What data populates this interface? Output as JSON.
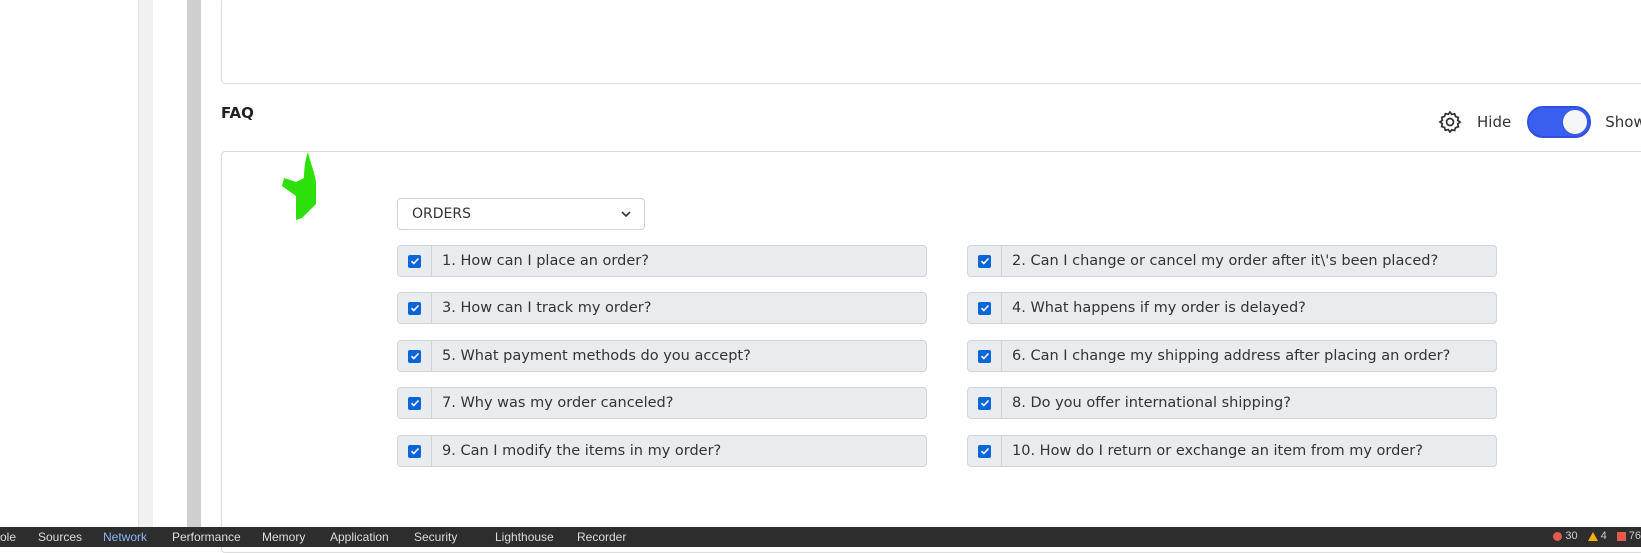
{
  "faq_section": {
    "title": "FAQ",
    "hide_label": "Hide",
    "show_label": "Show",
    "toggle_on": true,
    "category": "ORDERS"
  },
  "faq_items": [
    {
      "text": "1. How can I place an order?",
      "checked": true
    },
    {
      "text": "2. Can I change or cancel my order after it\\'s been placed?",
      "checked": true
    },
    {
      "text": "3. How can I track my order?",
      "checked": true
    },
    {
      "text": "4. What happens if my order is delayed?",
      "checked": true
    },
    {
      "text": "5. What payment methods do you accept?",
      "checked": true
    },
    {
      "text": "6. Can I change my shipping address after placing an order?",
      "checked": true
    },
    {
      "text": "7. Why was my order canceled?",
      "checked": true
    },
    {
      "text": "8. Do you offer international shipping?",
      "checked": true
    },
    {
      "text": "9. Can I modify the items in my order?",
      "checked": true
    },
    {
      "text": "10. How do I return or exchange an item from my order?",
      "checked": true
    }
  ],
  "devtools": {
    "tabs": [
      "ole",
      "Sources",
      "Network",
      "Performance",
      "Memory",
      "Application",
      "Security",
      "Lighthouse",
      "Recorder"
    ],
    "active_tab": "Network",
    "errors": "30",
    "warnings": "4",
    "issues": "76"
  },
  "colors": {
    "accent": "#3a5ef0",
    "checkbox": "#0a66d8",
    "annotation_green": "#2ee00a"
  }
}
